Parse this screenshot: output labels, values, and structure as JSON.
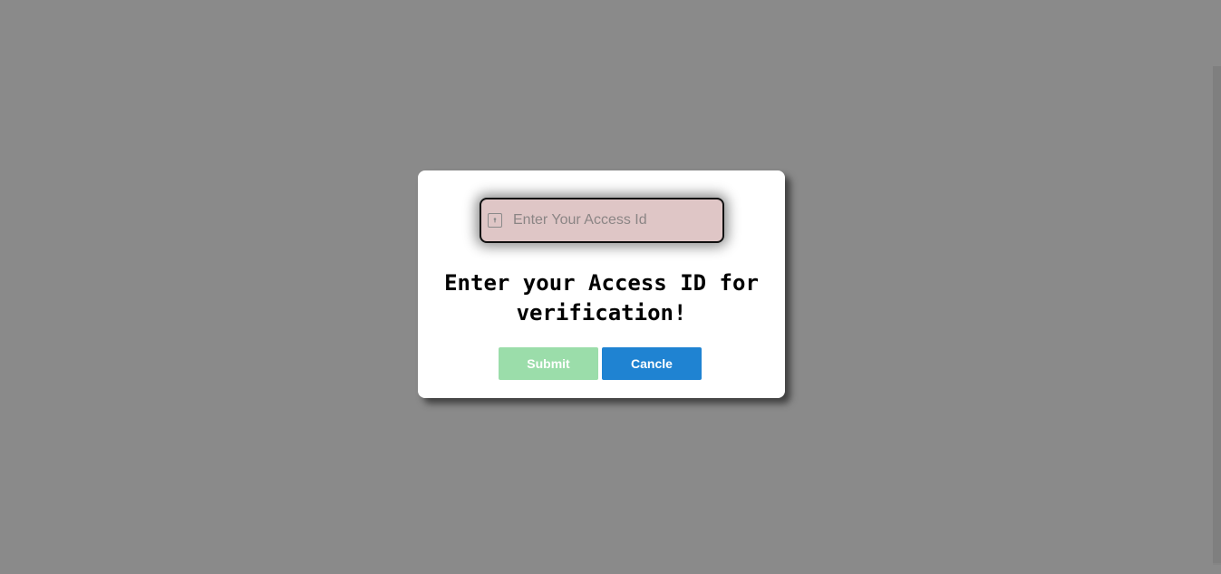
{
  "dialog": {
    "input": {
      "placeholder": "Enter Your Access Id",
      "value": "",
      "icon": "key-icon"
    },
    "prompt_text": "Enter your Access ID for verification!",
    "buttons": {
      "submit_label": "Submit",
      "cancel_label": "Cancle"
    }
  },
  "colors": {
    "overlay": "#8a8a8a",
    "input_background": "#dfc6c6",
    "submit_disabled": "#9bddaa",
    "cancel": "#1f83d2"
  }
}
